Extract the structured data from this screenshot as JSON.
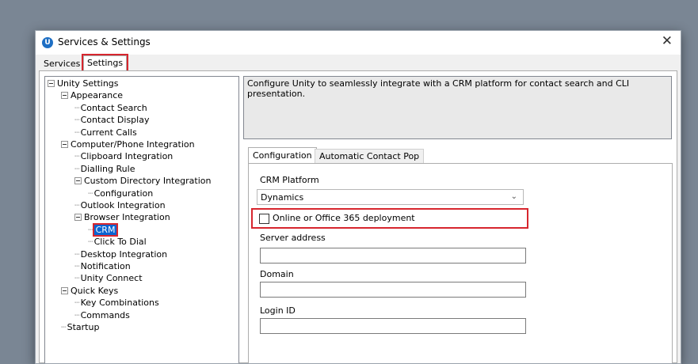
{
  "window": {
    "title": "Services & Settings",
    "app_icon_letter": "U",
    "close_glyph": "✕"
  },
  "tabs": {
    "services": "Services",
    "settings": "Settings"
  },
  "tree": [
    {
      "label": "Unity Settings",
      "level": 0,
      "expandable": true
    },
    {
      "label": "Appearance",
      "level": 1,
      "expandable": true
    },
    {
      "label": "Contact Search",
      "level": 2
    },
    {
      "label": "Contact Display",
      "level": 2
    },
    {
      "label": "Current Calls",
      "level": 2
    },
    {
      "label": "Computer/Phone Integration",
      "level": 1,
      "expandable": true
    },
    {
      "label": "Clipboard Integration",
      "level": 2
    },
    {
      "label": "Dialling Rule",
      "level": 2
    },
    {
      "label": "Custom Directory Integration",
      "level": 2,
      "expandable": true
    },
    {
      "label": "Configuration",
      "level": 3
    },
    {
      "label": "Outlook Integration",
      "level": 2
    },
    {
      "label": "Browser Integration",
      "level": 2,
      "expandable": true
    },
    {
      "label": "CRM",
      "level": 3,
      "selected": true
    },
    {
      "label": "Click To Dial",
      "level": 3
    },
    {
      "label": "Desktop Integration",
      "level": 2
    },
    {
      "label": "Notification",
      "level": 2
    },
    {
      "label": "Unity Connect",
      "level": 2
    },
    {
      "label": "Quick Keys",
      "level": 1,
      "expandable": true
    },
    {
      "label": "Key Combinations",
      "level": 2
    },
    {
      "label": "Commands",
      "level": 2
    },
    {
      "label": "Startup",
      "level": 1
    }
  ],
  "description": "Configure Unity to seamlessly integrate with a CRM platform for contact search and CLI presentation.",
  "config_tabs": {
    "configuration": "Configuration",
    "automatic_contact_pop": "Automatic Contact Pop"
  },
  "form": {
    "crm_platform_label": "CRM Platform",
    "crm_platform_value": "Dynamics",
    "online_checkbox_label": "Online or Office 365 deployment",
    "online_checked": false,
    "server_address_label": "Server address",
    "server_address_value": "",
    "domain_label": "Domain",
    "domain_value": "",
    "login_id_label": "Login ID",
    "login_id_value": ""
  },
  "colors": {
    "highlight": "#d7262e",
    "selection": "#0a64d2",
    "backdrop": "#7a8694"
  }
}
